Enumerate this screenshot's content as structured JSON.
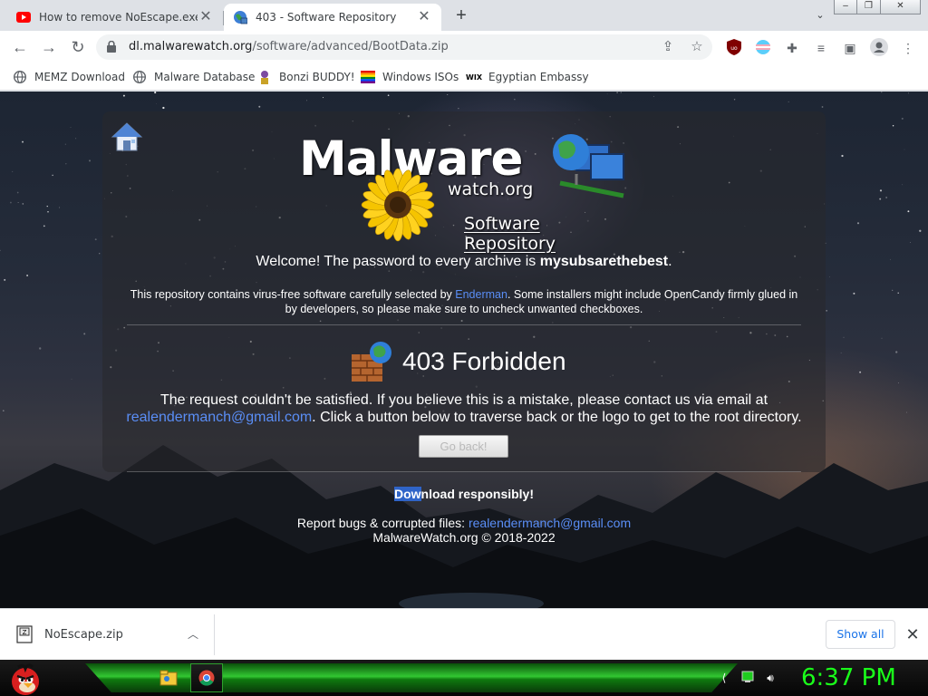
{
  "tabs": [
    {
      "title": "How to remove NoEscape.exe [D",
      "favicon": "youtube-icon"
    },
    {
      "title": "403 - Software Repository",
      "favicon": "globe-icon"
    }
  ],
  "window_buttons": {
    "minimize": "–",
    "restore": "❐",
    "close": "✕"
  },
  "toolbar": {
    "url_host": "dl.malwarewatch.org",
    "url_path": "/software/advanced/BootData.zip"
  },
  "bookmarks": [
    {
      "label": "MEMZ Download",
      "icon": "globe-icon"
    },
    {
      "label": "Malware Database",
      "icon": "globe-icon"
    },
    {
      "label": "Bonzi BUDDY!",
      "icon": "bonzi-icon"
    },
    {
      "label": "Windows ISOs",
      "icon": "rainbow-flag-icon"
    },
    {
      "label": "Egyptian Embassy",
      "icon": "wix-icon"
    }
  ],
  "bookmark_wix_text": "WIX",
  "page": {
    "logo": {
      "main": "Malware",
      "sub": "watch.org",
      "tagline": "Software Repository"
    },
    "welcome_prefix": "Welcome! The password to every archive is ",
    "password": "mysubsarethebest",
    "welcome_suffix": ".",
    "repo_prefix": "This repository contains virus-free software carefully selected by ",
    "repo_link": "Enderman",
    "repo_suffix": ". Some installers might include OpenCandy firmly glued in by developers, so please make sure to uncheck unwanted checkboxes.",
    "error_title": "403 Forbidden",
    "error_msg_prefix": "The request couldn't be satisfied. If you believe this is a mistake, please contact us via email at ",
    "error_email": "realendermanch@gmail.com",
    "error_msg_suffix": ". Click a button below to traverse back or the logo to get to the root directory.",
    "go_back": "Go back!",
    "dl_selected": "Dow",
    "dl_rest": "nload responsibly!",
    "report_prefix": "Report bugs & corrupted files: ",
    "report_email": "realendermanch@gmail.com",
    "copyright": "MalwareWatch.org © 2018-2022"
  },
  "downloads": {
    "file": "NoEscape.zip",
    "show_all": "Show all"
  },
  "taskbar": {
    "clock": "6:37 PM"
  },
  "colors": {
    "link": "#5a8ef6",
    "clock": "#1aff1a",
    "taskbar_accent": "#32c832",
    "selection": "#2f64c8"
  }
}
